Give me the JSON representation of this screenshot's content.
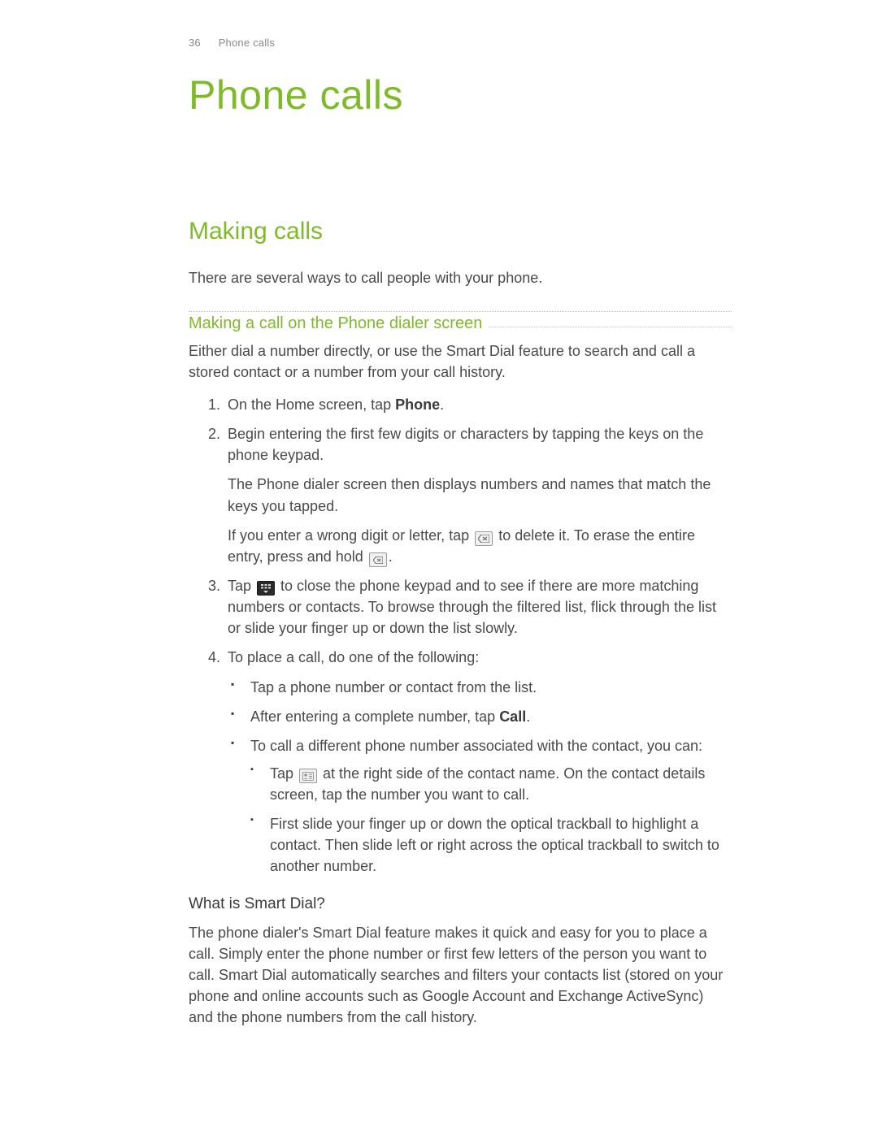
{
  "header": {
    "page_number": "36",
    "section": "Phone calls"
  },
  "chapter_title": "Phone calls",
  "section_title": "Making calls",
  "intro": "There are several ways to call people with your phone.",
  "sub_title": "Making a call on the Phone dialer screen",
  "sub_body": "Either dial a number directly, or use the Smart Dial feature to search and call a stored contact or a number from your call history.",
  "steps": {
    "s1_a": "On the Home screen, tap ",
    "s1_bold": "Phone",
    "s1_b": ".",
    "s2_p1": "Begin entering the first few digits or characters by tapping the keys on the phone keypad.",
    "s2_p2": "The Phone dialer screen then displays numbers and names that match the keys you tapped.",
    "s2_p3_a": "If you enter a wrong digit or letter, tap ",
    "s2_p3_b": " to delete it. To erase the entire entry, press and hold ",
    "s2_p3_c": ".",
    "s3_a": "Tap ",
    "s3_b": " to close the phone keypad and to see if there are more matching numbers or contacts. To browse through the filtered list, flick through the list or slide your finger up or down the list slowly.",
    "s4_lead": "To place a call, do one of the following:",
    "s4_b1": "Tap a phone number or contact from the list.",
    "s4_b2_a": "After entering a complete number, tap ",
    "s4_b2_bold": "Call",
    "s4_b2_b": ".",
    "s4_b3": "To call a different phone number associated with the contact, you can:",
    "s4_b3_i1_a": "Tap ",
    "s4_b3_i1_b": " at the right side of the contact name. On the contact details screen, tap the number you want to call.",
    "s4_b3_i2": "First slide your finger up or down the optical trackball to highlight a contact. Then slide left or right across the optical trackball to switch to another number."
  },
  "smart_dial": {
    "heading": "What is Smart Dial?",
    "body": "The phone dialer's Smart Dial feature makes it quick and easy for you to place a call. Simply enter the phone number or first few letters of the person you want to call. Smart Dial automatically searches and filters your contacts list (stored on your phone and online accounts such as Google Account and Exchange ActiveSync) and the phone numbers from the call history."
  }
}
